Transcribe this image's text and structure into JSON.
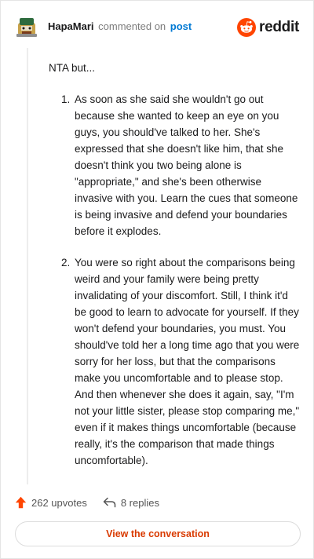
{
  "header": {
    "author": "HapaMari",
    "action": "commented on",
    "post_link": "post",
    "brand": "reddit"
  },
  "comment": {
    "intro": "NTA but...",
    "points": [
      "As soon as she said she wouldn't go out because she wanted to keep an eye on you guys, you should've talked to her. She's expressed that she doesn't like him, that she doesn't think you two being alone is \"appropriate,\" and she's been otherwise invasive with you. Learn the cues that someone is being invasive and defend your boundaries before it explodes.",
      "You were so right about the comparisons being weird and your family were being pretty invalidating of your discomfort. Still, I think it'd be good to learn to advocate for yourself. If they won't defend your boundaries, you must. You should've told her a long time ago that you were sorry for her loss, but that the comparisons make you uncomfortable and to please stop. And then whenever she does it again, say, \"I'm not your little sister, please stop comparing me,\" even if it makes things uncomfortable (because really, it's the comparison that made things uncomfortable)."
    ]
  },
  "footer": {
    "upvotes": "262 upvotes",
    "replies": "8 replies",
    "view_button": "View the conversation"
  },
  "colors": {
    "brand_orange": "#ff4500",
    "upvote": "#ff4500",
    "link_blue": "#0079d3",
    "button_text": "#d93a00"
  },
  "icons": {
    "avatar": "snoo-avatar",
    "brand": "reddit-snoo-icon",
    "upvote": "upvote-arrow-icon",
    "reply": "reply-arrow-icon"
  }
}
